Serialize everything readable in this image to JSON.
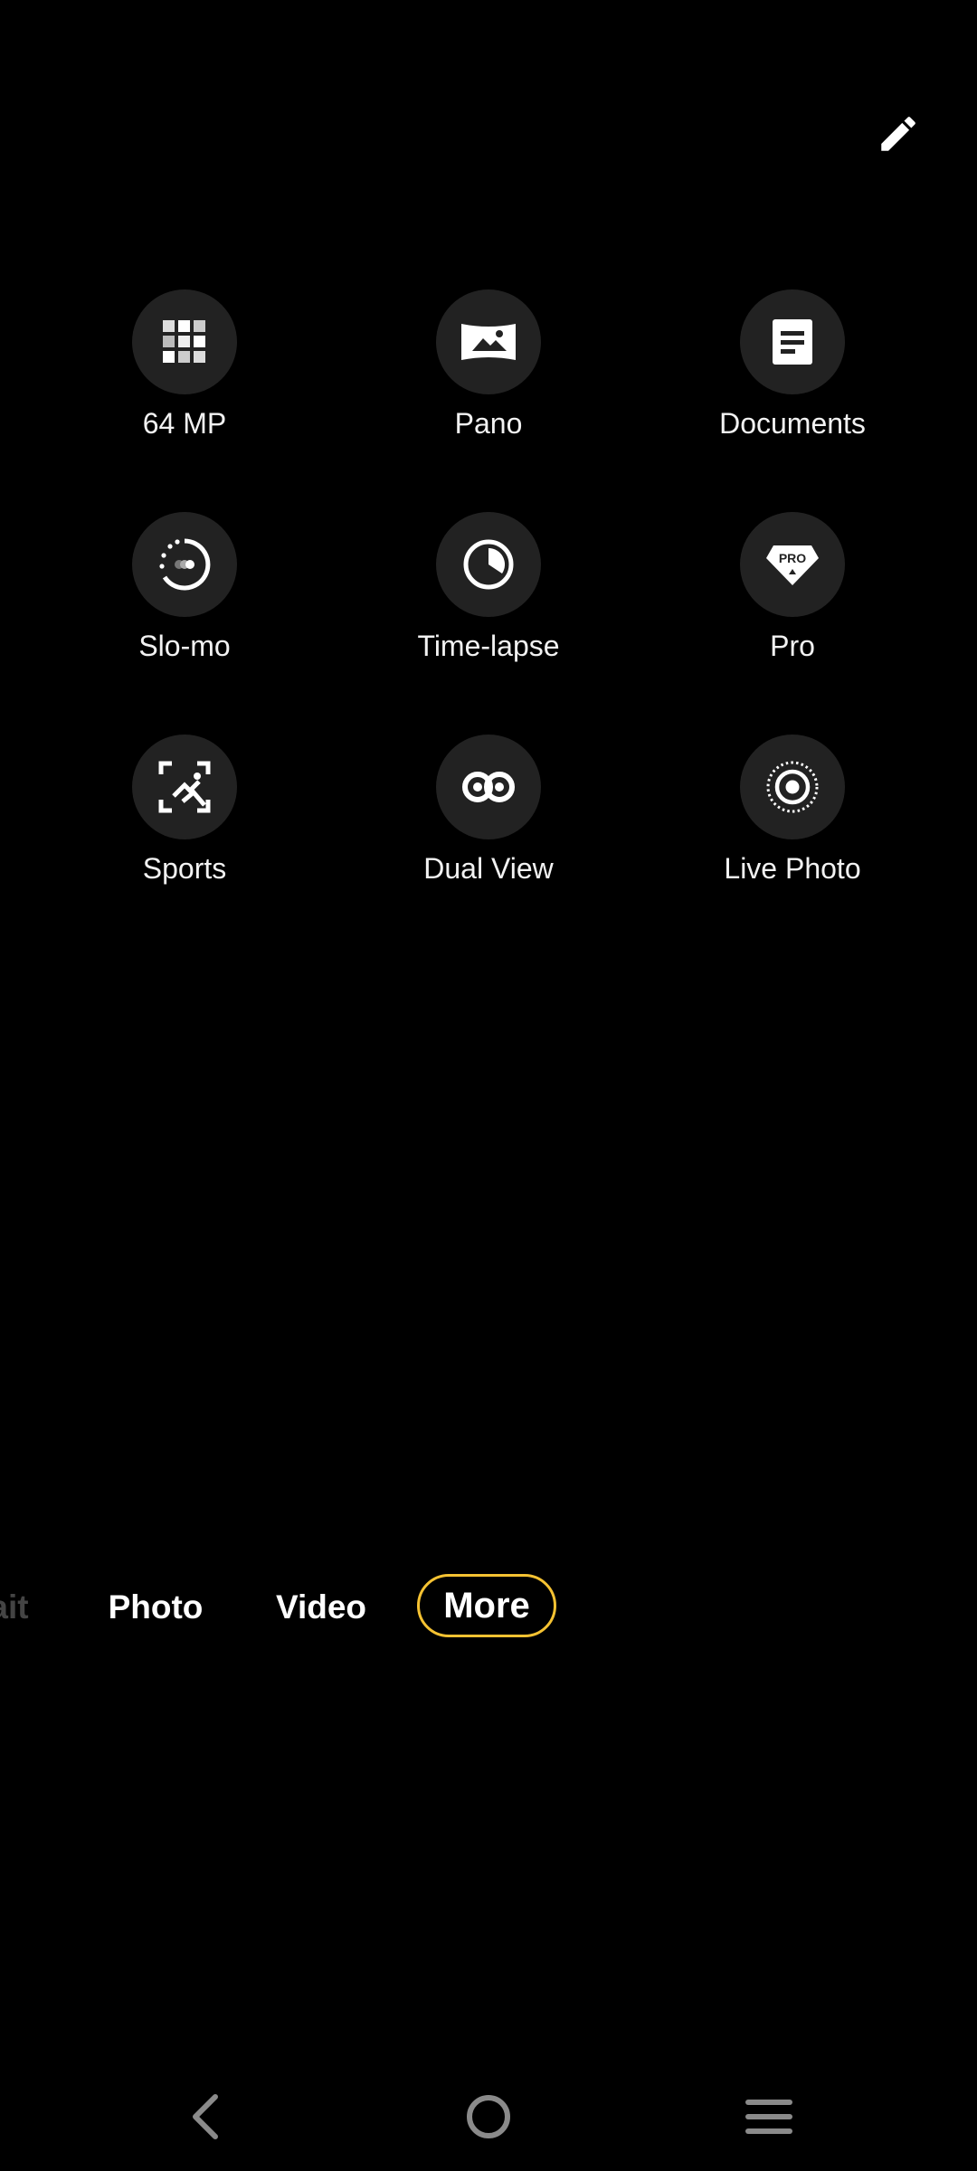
{
  "header": {
    "edit_icon": "pencil-icon"
  },
  "modes": [
    {
      "label": "64 MP",
      "icon": "grid-64mp-icon"
    },
    {
      "label": "Pano",
      "icon": "panorama-icon"
    },
    {
      "label": "Documents",
      "icon": "document-icon"
    },
    {
      "label": "Slo-mo",
      "icon": "slow-motion-icon"
    },
    {
      "label": "Time-lapse",
      "icon": "clock-icon"
    },
    {
      "label": "Pro",
      "icon": "pro-icon"
    },
    {
      "label": "Sports",
      "icon": "sports-icon"
    },
    {
      "label": "Dual View",
      "icon": "dual-view-icon"
    },
    {
      "label": "Live Photo",
      "icon": "live-photo-icon"
    }
  ],
  "mode_bar": {
    "portrait_partial": "ait",
    "photo": "Photo",
    "video": "Video",
    "more": "More",
    "selected": "More",
    "accent_color": "#f5c232"
  },
  "navbar": {
    "back_icon": "back-icon",
    "home_icon": "home-icon",
    "menu_icon": "menu-icon"
  }
}
